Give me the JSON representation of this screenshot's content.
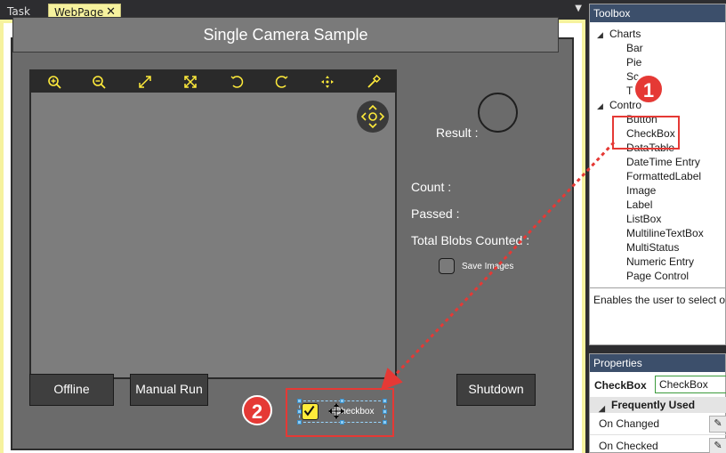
{
  "tabs": {
    "task": "Task",
    "webpage": "WebPage",
    "close": "✕",
    "menu": "▼"
  },
  "page": {
    "title": "Single Camera Sample",
    "result_label": "Result :",
    "count_label": "Count :",
    "passed_label": "Passed :",
    "total_blobs_label": "Total Blobs Counted :",
    "save_images_label": "Save Images",
    "buttons": {
      "offline": "Offline",
      "manual_run": "Manual Run",
      "shutdown": "Shutdown"
    },
    "dropped_checkbox_text": "Checkbox"
  },
  "camera_toolbar_icons": [
    "zoom-in-icon",
    "zoom-out-icon",
    "fit-diagonal-icon",
    "fit-all-icon",
    "rotate-left-icon",
    "rotate-right-icon",
    "pan-icon",
    "eyedropper-icon"
  ],
  "annotations": {
    "badge_1": "1",
    "badge_2": "2"
  },
  "toolbox": {
    "title": "Toolbox",
    "charts_group": "Charts",
    "charts_items": [
      "Bar",
      "Pie",
      "Sc",
      "T"
    ],
    "controls_group": "Contro",
    "controls_items": [
      "Button",
      "CheckBox",
      "DataTable",
      "DateTime Entry",
      "FormattedLabel",
      "Image",
      "Label",
      "ListBox",
      "MultilineTextBox",
      "MultiStatus",
      "Numeric Entry",
      "Page Control"
    ],
    "description": "Enables the user to select or"
  },
  "properties": {
    "title": "Properties",
    "type_label": "CheckBox",
    "name_value": "CheckBox",
    "category": "Frequently Used",
    "rows": [
      "On Changed",
      "On Checked"
    ]
  },
  "colors": {
    "accent_yellow": "#ffeb3b",
    "annotation_red": "#e53935",
    "panel_header": "#3c4f6b"
  }
}
